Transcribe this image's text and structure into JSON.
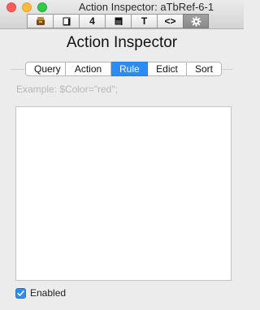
{
  "window": {
    "title": "Action Inspector: aTbRef-6-1"
  },
  "toolbar": {
    "buttons": [
      {
        "icon": "properties-icon"
      },
      {
        "icon": "note-icon"
      },
      {
        "icon": "number-4-icon",
        "glyph": "4"
      },
      {
        "icon": "appearance-icon"
      },
      {
        "icon": "text-icon",
        "glyph": "T"
      },
      {
        "icon": "code-icon",
        "glyph": "<>"
      },
      {
        "icon": "gear-icon",
        "active": true
      }
    ]
  },
  "inspector": {
    "heading": "Action Inspector"
  },
  "tabs": [
    {
      "label": "Query"
    },
    {
      "label": "Action"
    },
    {
      "label": "Rule",
      "active": true
    },
    {
      "label": "Edict"
    },
    {
      "label": "Sort"
    }
  ],
  "rule": {
    "placeholder": "Example: $Color=\"red\";",
    "code": ""
  },
  "enabled": {
    "label": "Enabled",
    "checked": true
  },
  "colors": {
    "accent": "#2a8cf6",
    "close": "#fc605c",
    "minimize": "#fdbc40",
    "maximize": "#34c84a"
  }
}
